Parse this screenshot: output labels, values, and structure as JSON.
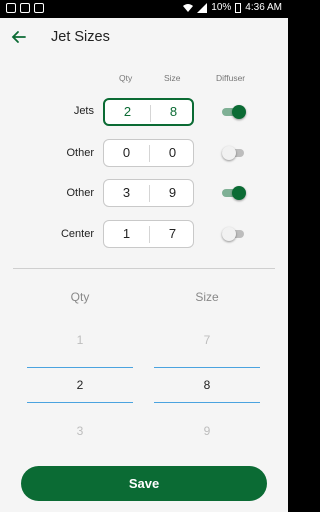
{
  "status_bar": {
    "battery": "10%",
    "time": "4:36 AM"
  },
  "header": {
    "title": "Jet Sizes",
    "back_icon": "arrow-back-icon"
  },
  "columns": {
    "qty": "Qty",
    "size": "Size",
    "diffuser": "Diffuser"
  },
  "rows": [
    {
      "label": "Jets",
      "qty": "2",
      "size": "8",
      "diffuser_on": true,
      "selected": true
    },
    {
      "label": "Other",
      "qty": "0",
      "size": "0",
      "diffuser_on": false,
      "selected": false
    },
    {
      "label": "Other",
      "qty": "3",
      "size": "9",
      "diffuser_on": true,
      "selected": false
    },
    {
      "label": "Center",
      "qty": "1",
      "size": "7",
      "diffuser_on": false,
      "selected": false
    }
  ],
  "picker": {
    "qty_label": "Qty",
    "size_label": "Size",
    "qty": {
      "prev": "1",
      "current": "2",
      "next": "3"
    },
    "size": {
      "prev": "7",
      "current": "8",
      "next": "9"
    }
  },
  "save_label": "Save",
  "colors": {
    "primary": "#0b6b34",
    "picker_line": "#4aa3df"
  }
}
